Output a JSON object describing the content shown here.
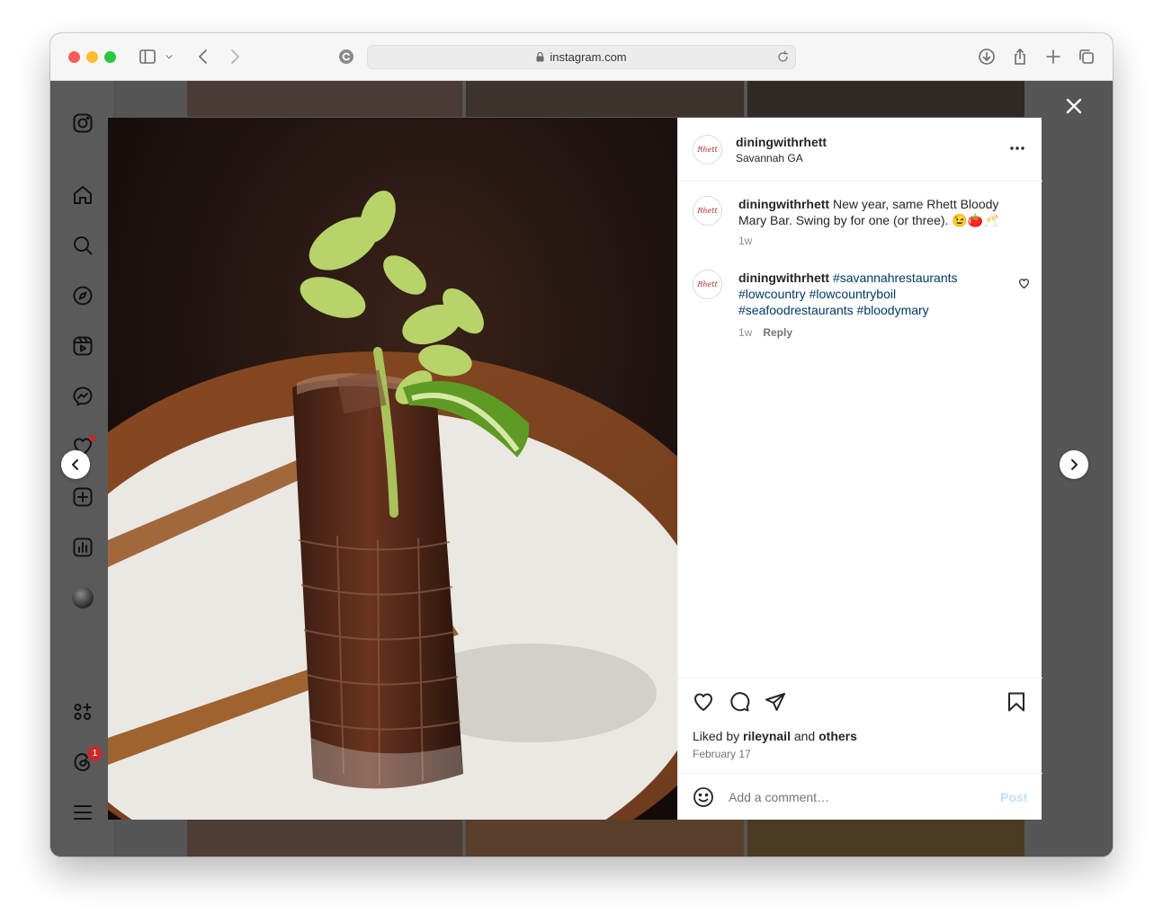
{
  "browser": {
    "url": "instagram.com"
  },
  "post": {
    "author": "diningwithrhett",
    "avatar_text": "Rhett",
    "location": "Savannah GA",
    "caption": {
      "author": "diningwithrhett",
      "text": "New year, same Rhett Bloody Mary Bar. Swing by for one (or three). 😉🍅🥂",
      "time": "1w"
    },
    "comment": {
      "author": "diningwithrhett",
      "hashtags": [
        "#savannahrestaurants",
        "#lowcountry",
        "#lowcountryboil",
        "#seafoodrestaurants",
        "#bloodymary"
      ],
      "time": "1w",
      "reply_label": "Reply"
    },
    "likes": {
      "prefix": "Liked by",
      "user": "rileynail",
      "joiner": "and",
      "others": "others"
    },
    "date": "February 17",
    "add_comment_placeholder": "Add a comment…",
    "post_label": "Post"
  },
  "sidebar": {
    "notifications_badge": "1"
  },
  "colors": {
    "link": "#00376b",
    "post_disabled": "#c0dffd",
    "badge": "#c42b2b"
  }
}
